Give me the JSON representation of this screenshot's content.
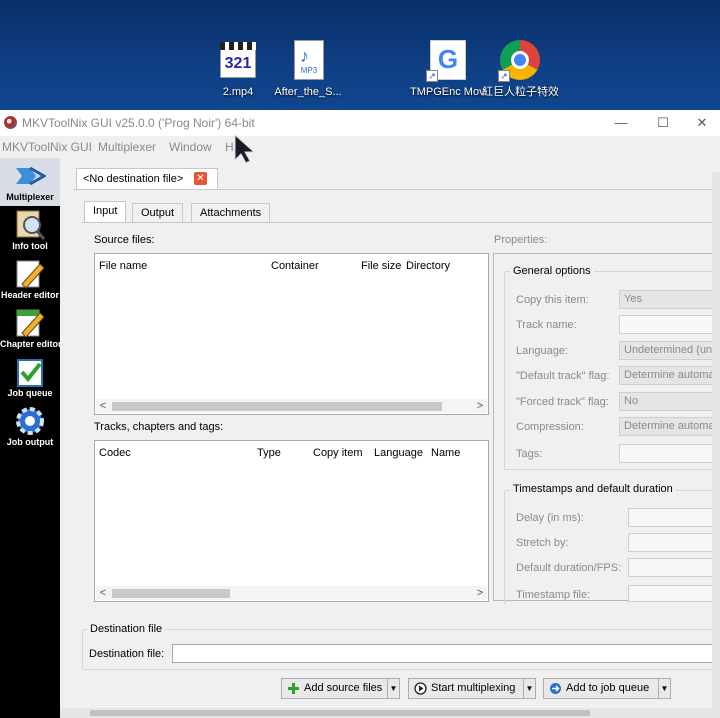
{
  "desktop": {
    "icons": [
      {
        "label": "2.mp4",
        "glyph_text": "321"
      },
      {
        "label": "After_the_S...",
        "glyph_text": "MP3"
      },
      {
        "label": "TMPGEnc Movie Plu...",
        "glyph_text": "G"
      },
      {
        "label": "紅巨人粒子特效套装",
        "glyph_text": ""
      }
    ]
  },
  "window": {
    "title": "MKVToolNix GUI v25.0.0 ('Prog Noir') 64-bit",
    "minimize": "—",
    "maximize": "☐",
    "close": "✕"
  },
  "menu": {
    "items": [
      "MKVToolNix GUI",
      "Multiplexer",
      "Window",
      "H"
    ]
  },
  "sidebar": {
    "items": [
      {
        "label": "Multiplexer",
        "icon": "multiplexer-icon"
      },
      {
        "label": "Info tool",
        "icon": "magnifier-icon"
      },
      {
        "label": "Header editor",
        "icon": "pencil-icon"
      },
      {
        "label": "Chapter editor",
        "icon": "chapter-pencil-icon"
      },
      {
        "label": "Job queue",
        "icon": "checklist-icon"
      },
      {
        "label": "Job output",
        "icon": "gear-icon"
      }
    ]
  },
  "file_tab": {
    "label": "<No destination file>",
    "close": "✕"
  },
  "subtabs": [
    "Input",
    "Output",
    "Attachments"
  ],
  "input": {
    "source_files_label": "Source files:",
    "source_columns": [
      "File name",
      "Container",
      "File size",
      "Directory"
    ],
    "tracks_label": "Tracks, chapters and tags:",
    "track_columns": [
      "Codec",
      "Type",
      "Copy item",
      "Language",
      "Name"
    ],
    "scroll_left": "<",
    "scroll_right": ">"
  },
  "properties": {
    "label": "Properties:",
    "general_title": "General options",
    "general": [
      {
        "label": "Copy this item:",
        "value": "Yes",
        "combo": true
      },
      {
        "label": "Track name:",
        "value": "",
        "combo": false
      },
      {
        "label": "Language:",
        "value": "Undetermined (und)",
        "combo": true
      },
      {
        "label": "\"Default track\" flag:",
        "value": "Determine automatically",
        "combo": true
      },
      {
        "label": "\"Forced track\" flag:",
        "value": "No",
        "combo": true
      },
      {
        "label": "Compression:",
        "value": "Determine automatically",
        "combo": true
      },
      {
        "label": "Tags:",
        "value": "",
        "combo": false
      }
    ],
    "timestamps_title": "Timestamps and default duration",
    "timestamps": [
      {
        "label": "Delay (in ms):",
        "value": ""
      },
      {
        "label": "Stretch by:",
        "value": ""
      },
      {
        "label": "Default duration/FPS:",
        "value": ""
      },
      {
        "label": "Timestamp file:",
        "value": ""
      }
    ]
  },
  "destination": {
    "group_title": "Destination file",
    "field_label": "Destination file:",
    "value": ""
  },
  "actions": {
    "add_source": "Add source files",
    "start_mux": "Start multiplexing",
    "add_queue": "Add to job queue",
    "dropdown": "▼"
  },
  "colors": {
    "accent_green": "#2aa12a",
    "close_red": "#e8533a",
    "sidebar_bg": "#000000",
    "desktop_blue": "#0f3f84"
  }
}
